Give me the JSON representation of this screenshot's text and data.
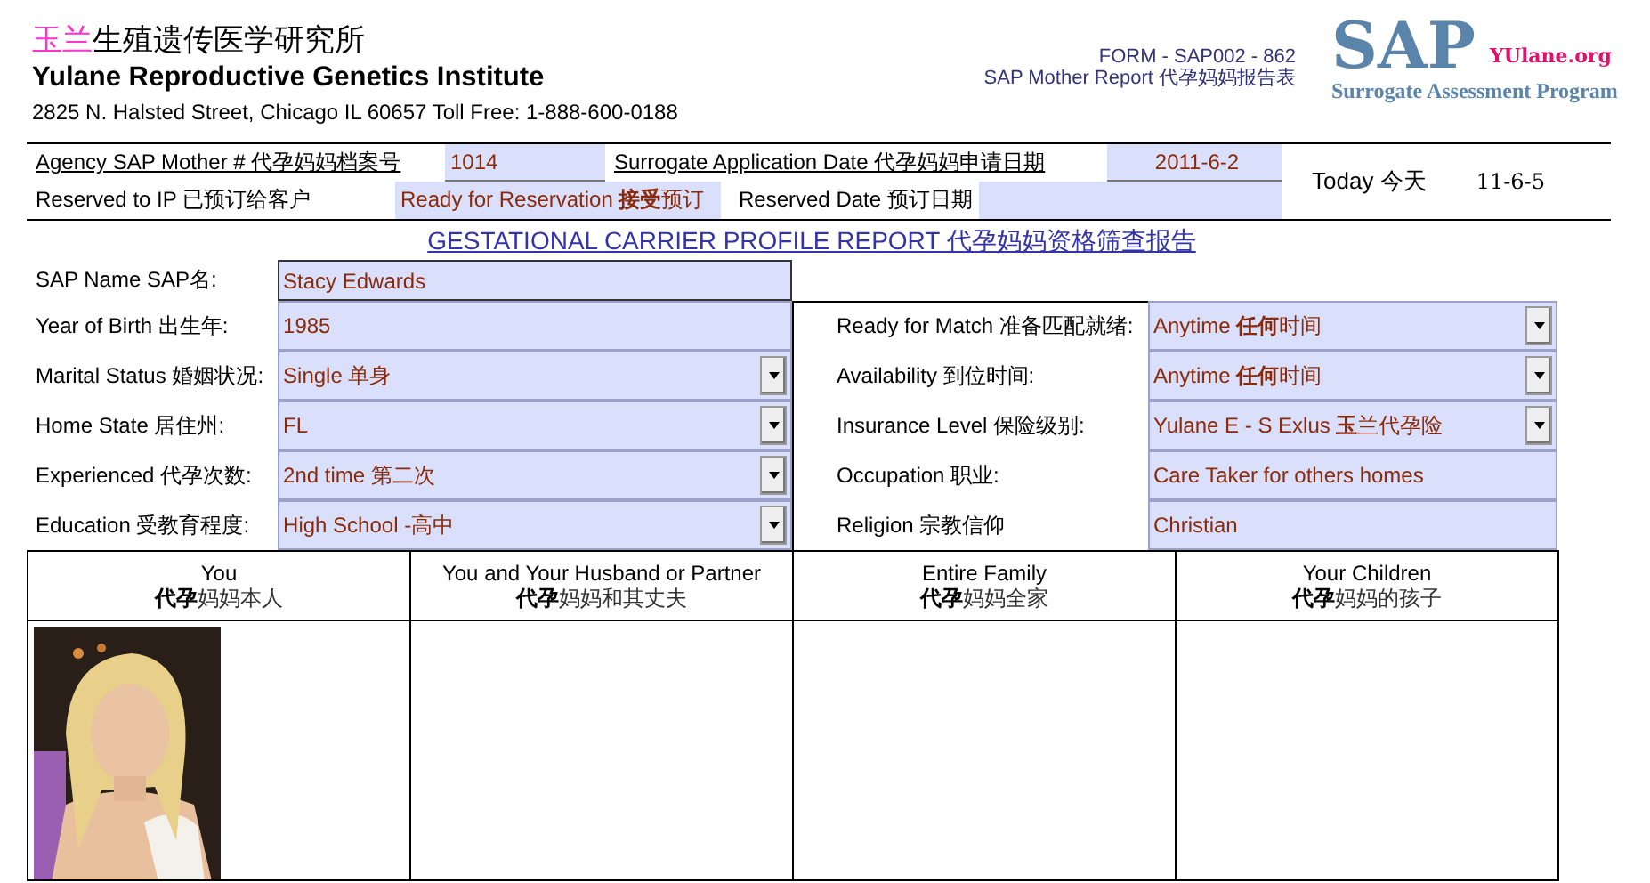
{
  "header": {
    "title_cn": {
      "highlight": "玉兰",
      "rest": "生殖遗传医学研究所"
    },
    "title_en": "Yulane Reproductive Genetics Institute",
    "address": "2825 N. Halsted Street, Chicago IL 60657  Toll Free: 1-888-600-0188",
    "form_code": "FORM - SAP002 - 862",
    "form_name": "SAP Mother Report 代孕妈妈报告表",
    "logo": {
      "mark": "SAP",
      "site": "YUlane.org",
      "tagline": "Surrogate Assessment Program"
    }
  },
  "info": {
    "mother_label": "Agency SAP Mother  # 代孕妈妈档案号",
    "mother_value": "1014",
    "application_label": "Surrogate Application Date 代孕妈妈申请日期",
    "application_value": "2011-6-2",
    "reserved_label": "Reserved to IP  已预订给客户",
    "reserved_value": "Ready for Reservation **接受**预订",
    "reserved_date_label": "Reserved Date 预订日期",
    "today_label": "Today 今天",
    "today_value": "11-6-5"
  },
  "report_title": "GESTATIONAL CARRIER PROFILE REPORT 代孕妈妈资格筛查报告",
  "name_field": {
    "label": "SAP Name SAP名:",
    "value": "Stacy Edwards"
  },
  "left_fields": [
    {
      "label": "Year of Birth 出生年:",
      "value": "1985",
      "kind": "text"
    },
    {
      "label": "Marital Status 婚姻状况:",
      "value": "Single 单身",
      "kind": "dropdown"
    },
    {
      "label": "Home State 居住州:",
      "value": "FL",
      "kind": "dropdown"
    },
    {
      "label": "Experienced  代孕次数:",
      "value": "2nd time 第二次",
      "kind": "dropdown"
    },
    {
      "label": "Education 受教育程度:",
      "value": "High School -高中",
      "kind": "dropdown"
    }
  ],
  "right_fields": [
    {
      "label": "Ready for Match 准备匹配就绪:",
      "value": "Anytime **任何**时间",
      "kind": "dropdown"
    },
    {
      "label": "Availability 到位时间:",
      "value": "Anytime **任何**时间",
      "kind": "dropdown"
    },
    {
      "label": "Insurance Level 保险级别:",
      "value": "Yulane E - S Exlus **玉**兰代孕险",
      "kind": "dropdown"
    },
    {
      "label": "Occupation  职业:",
      "value": "Care Taker for others homes",
      "kind": "text"
    },
    {
      "label": "Religion 宗教信仰",
      "value": "Christian",
      "kind": "text"
    }
  ],
  "photo_table": {
    "columns": [
      {
        "title": "You",
        "subtitle": "**代孕**妈妈本人"
      },
      {
        "title": "You and Your Husband or Partner",
        "subtitle": "**代孕**妈妈和其丈夫"
      },
      {
        "title": "Entire Family",
        "subtitle": "**代孕**妈妈全家"
      },
      {
        "title": "Your Children",
        "subtitle": "**代孕**妈妈的孩子"
      }
    ]
  }
}
